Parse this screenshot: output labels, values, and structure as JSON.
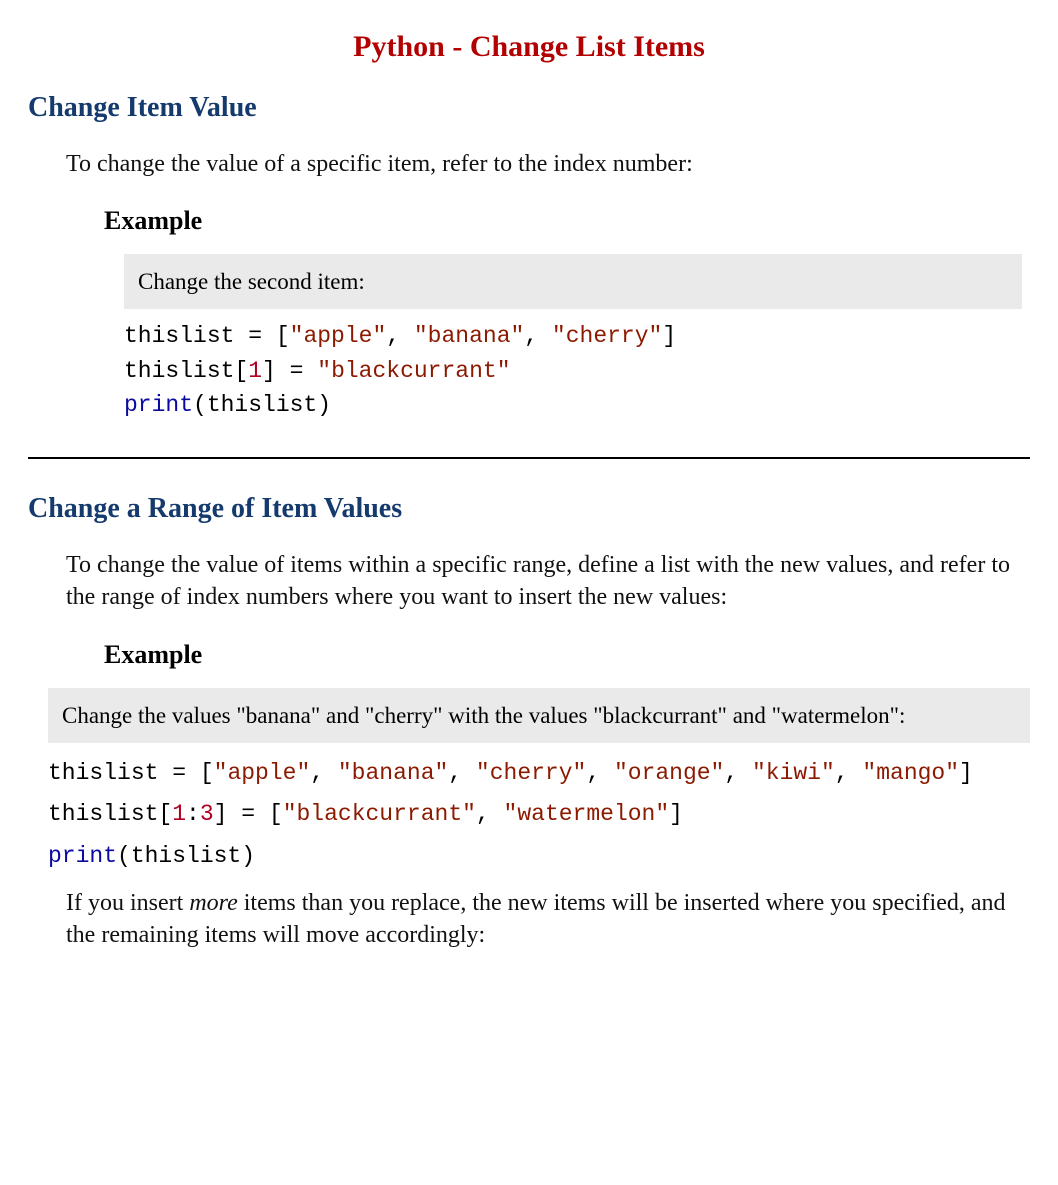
{
  "title": "Python - Change List Items",
  "section1": {
    "heading": "Change Item Value",
    "para": "To change the value of a specific item, refer to the index number:",
    "example_label": "Example",
    "caption": "Change the second item:",
    "code": {
      "line1_a": "thislist = [",
      "line1_s1": "\"apple\"",
      "line1_b": ", ",
      "line1_s2": "\"banana\"",
      "line1_c": ", ",
      "line1_s3": "\"cherry\"",
      "line1_d": "]",
      "line2_a": "thislist[",
      "line2_n1": "1",
      "line2_b": "] = ",
      "line2_s1": "\"blackcurrant\"",
      "line3_fn": "print",
      "line3_a": "(thislist)"
    }
  },
  "section2": {
    "heading": "Change a Range of Item Values",
    "para": "To change the value of items within a specific range, define a list with the new values, and refer to the range of index numbers where you want to insert the new values:",
    "example_label": "Example",
    "caption": "Change the values \"banana\" and \"cherry\" with the values \"blackcurrant\" and \"watermelon\":",
    "code": {
      "line1_a": "thislist = [",
      "line1_s1": "\"apple\"",
      "line1_b": ", ",
      "line1_s2": "\"banana\"",
      "line1_c": ", ",
      "line1_s3": "\"cherry\"",
      "line1_d": ", ",
      "line1_s4": "\"orange\"",
      "line1_e": ", ",
      "line1_s5": "\"kiwi\"",
      "line1_f": ", ",
      "line1_s6": "\"mango\"",
      "line1_g": "]",
      "line2_a": "thislist[",
      "line2_n1": "1",
      "line2_b": ":",
      "line2_n2": "3",
      "line2_c": "] = [",
      "line2_s1": "\"blackcurrant\"",
      "line2_d": ", ",
      "line2_s2": "\"watermelon\"",
      "line2_e": "]",
      "line3_fn": "print",
      "line3_a": "(thislist)"
    },
    "para2_a": "If you insert ",
    "para2_em": "more",
    "para2_b": " items than you replace, the new items will be inserted where you specified, and the remaining items will move accordingly:"
  }
}
